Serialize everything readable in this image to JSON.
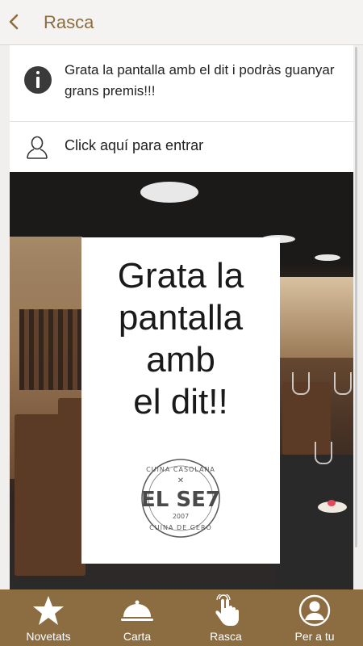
{
  "header": {
    "title": "Rasca"
  },
  "info": {
    "text": "Grata la pantalla amb el dit i podràs guanyar grans premis!!!"
  },
  "login": {
    "text": "Click aquí para entrar"
  },
  "scratch_card": {
    "message": "Grata la\npantalla\namb\nel dit!!",
    "logo": {
      "top": "CUINA CASOLANA",
      "name": "EL SE7",
      "year": "2007",
      "bottom": "CUINA DE GERO"
    }
  },
  "tabs": [
    {
      "label": "Novetats",
      "icon": "star-icon"
    },
    {
      "label": "Carta",
      "icon": "cloche-icon"
    },
    {
      "label": "Rasca",
      "icon": "hand-pointer-icon"
    },
    {
      "label": "Per a tu",
      "icon": "user-circle-icon"
    }
  ],
  "colors": {
    "accent": "#8c6d42",
    "title": "#8c6d3f"
  }
}
